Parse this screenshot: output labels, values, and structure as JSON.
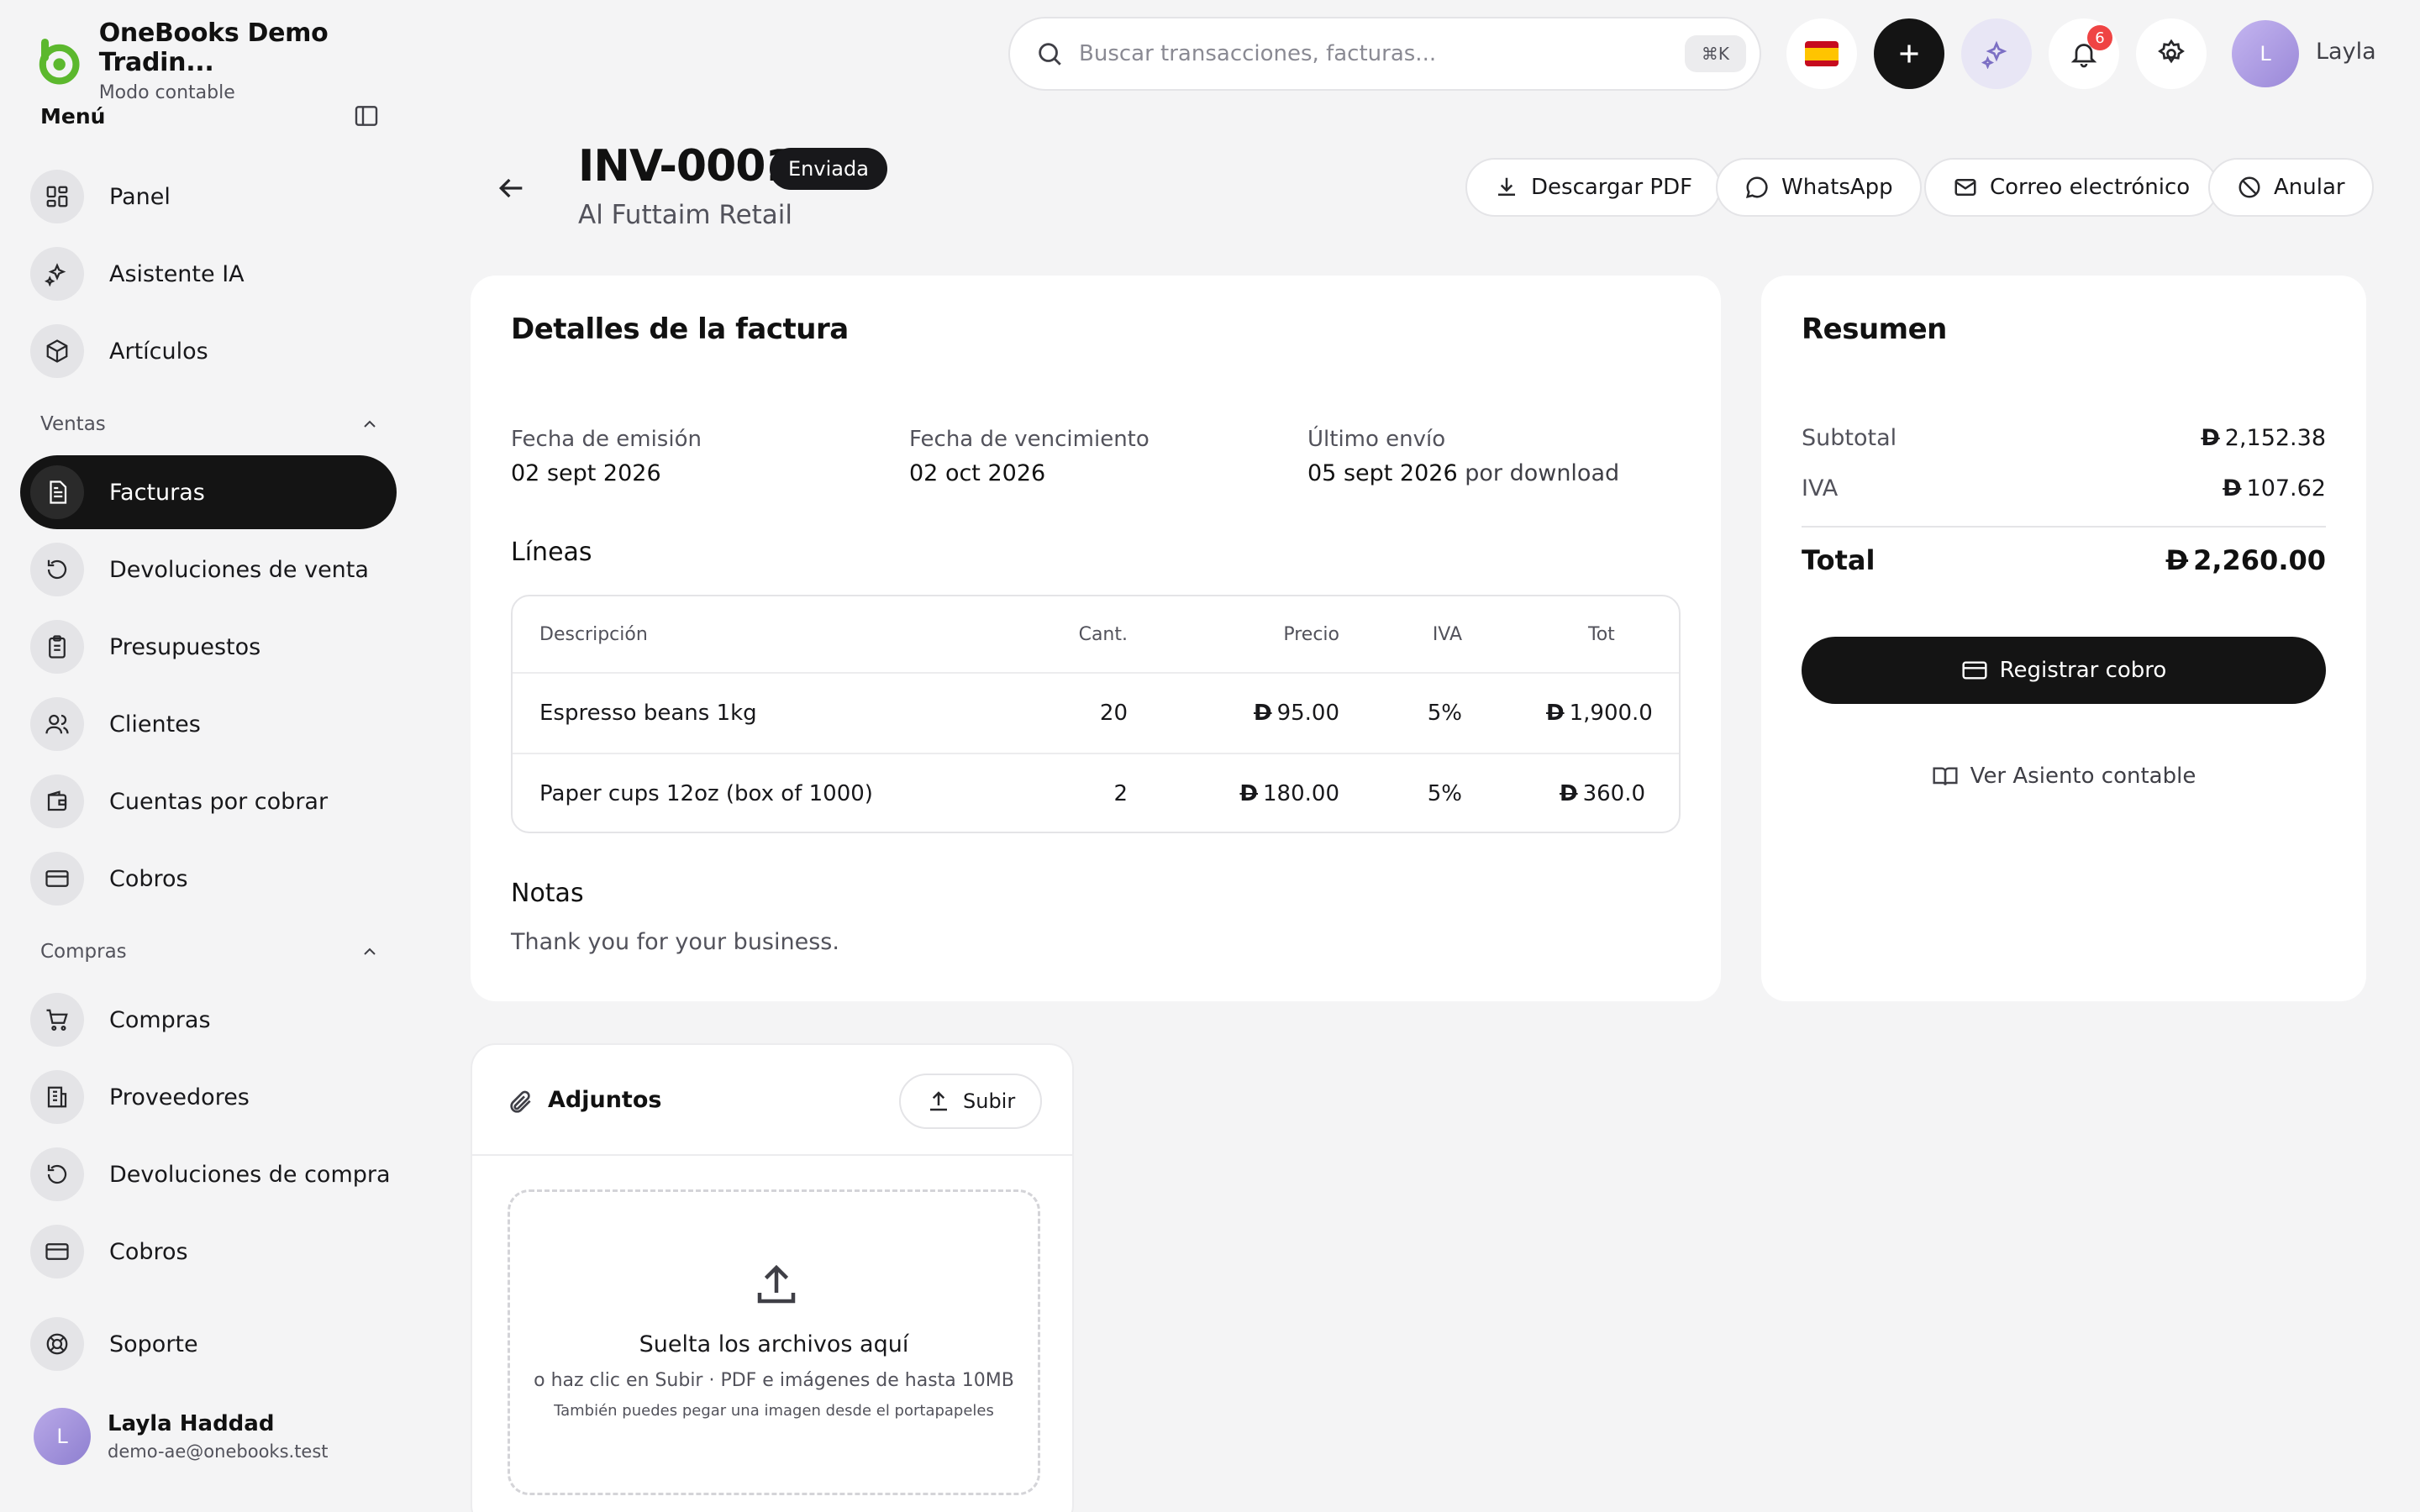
{
  "brand": {
    "name": "OneBooks Demo Tradin...",
    "subtitle": "Modo contable",
    "color": "#5cb82e"
  },
  "sidebar": {
    "menu_title": "Menú",
    "top_items": [
      {
        "label": "Panel",
        "icon": "dashboard-icon"
      },
      {
        "label": "Asistente IA",
        "icon": "sparkles-icon"
      },
      {
        "label": "Artículos",
        "icon": "box-icon"
      }
    ],
    "sales_section": "Ventas",
    "sales_items": [
      {
        "label": "Facturas",
        "icon": "invoice-icon",
        "active": true
      },
      {
        "label": "Devoluciones de venta",
        "icon": "undo-icon"
      },
      {
        "label": "Presupuestos",
        "icon": "clipboard-icon"
      },
      {
        "label": "Clientes",
        "icon": "users-icon"
      },
      {
        "label": "Cuentas por cobrar",
        "icon": "wallet-icon"
      },
      {
        "label": "Cobros",
        "icon": "credit-card-icon"
      }
    ],
    "purchases_section": "Compras",
    "purchase_items": [
      {
        "label": "Compras",
        "icon": "cart-icon"
      },
      {
        "label": "Proveedores",
        "icon": "building-icon"
      },
      {
        "label": "Devoluciones de compra",
        "icon": "undo-icon"
      },
      {
        "label": "Cobros",
        "icon": "credit-card-icon"
      }
    ],
    "support": {
      "label": "Soporte",
      "icon": "lifebuoy-icon"
    },
    "user": {
      "initial": "L",
      "name": "Layla Haddad",
      "email": "demo-ae@onebooks.test"
    }
  },
  "topbar": {
    "search_placeholder": "Buscar transacciones, facturas...",
    "shortcut": "⌘K",
    "notifications_count": "6",
    "user_initial": "L",
    "user_name": "Layla"
  },
  "invoice": {
    "number": "INV-0001",
    "status": "Enviada",
    "customer": "Al Futtaim Retail",
    "actions": {
      "download": "Descargar PDF",
      "whatsapp": "WhatsApp",
      "email": "Correo electrónico",
      "void": "Anular"
    },
    "details_title": "Detalles de la factura",
    "issue_label": "Fecha de emisión",
    "issue_date": "02 sept 2026",
    "due_label": "Fecha de vencimiento",
    "due_date": "02 oct 2026",
    "last_sent_label": "Último envío",
    "last_sent_date": "05 sept 2026",
    "last_sent_via": "por download",
    "lines_title": "Líneas",
    "columns": {
      "desc": "Descripción",
      "qty": "Cant.",
      "price": "Precio",
      "iva": "IVA",
      "total": "Tot"
    },
    "currency_symbol": "D",
    "lines": [
      {
        "desc": "Espresso beans 1kg",
        "qty": "20",
        "price": "95.00",
        "iva": "5%",
        "total": "1,900.0"
      },
      {
        "desc": "Paper cups 12oz (box of 1000)",
        "qty": "2",
        "price": "180.00",
        "iva": "5%",
        "total": "360.0"
      }
    ],
    "notes_title": "Notas",
    "notes": "Thank you for your business."
  },
  "summary": {
    "title": "Resumen",
    "subtotal_label": "Subtotal",
    "subtotal": "2,152.38",
    "iva_label": "IVA",
    "iva": "107.62",
    "total_label": "Total",
    "total": "2,260.00",
    "register_payment": "Registrar cobro",
    "ledger_link": "Ver Asiento contable"
  },
  "attachments": {
    "title": "Adjuntos",
    "upload": "Subir",
    "drop_title": "Suelta los archivos aquí",
    "drop_sub": "o haz clic en Subir · PDF e imágenes de hasta 10MB",
    "drop_hint": "También puedes pegar una imagen desde el portapapeles"
  }
}
